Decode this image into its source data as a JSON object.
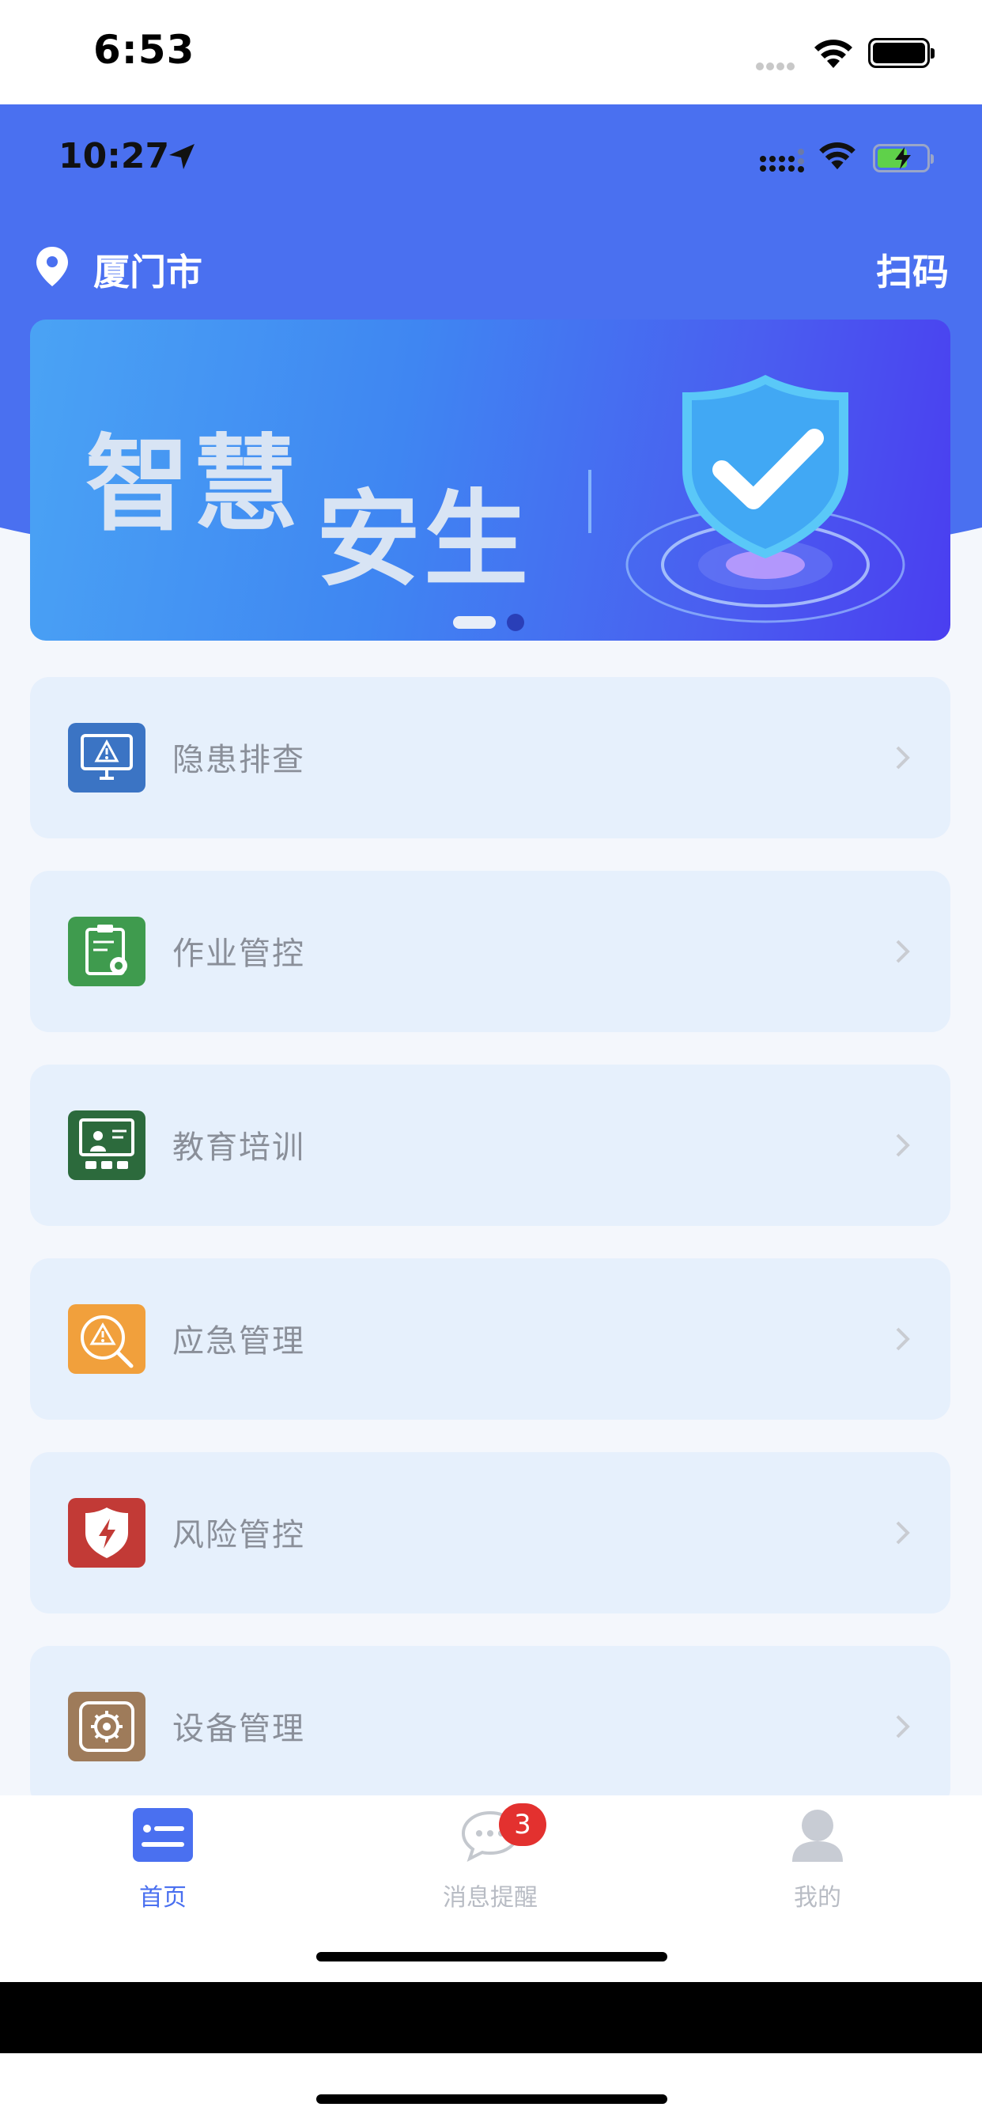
{
  "outer_status": {
    "time": "6:53"
  },
  "inner_status": {
    "time": "10:27"
  },
  "header": {
    "city": "厦门市",
    "scan_label": "扫码"
  },
  "banner": {
    "title_part1": "智慧",
    "title_part2": "安生"
  },
  "menu": [
    {
      "label": "隐患排查",
      "icon": "monitor-warning-icon",
      "color": "#3b74c4"
    },
    {
      "label": "作业管控",
      "icon": "clipboard-gear-icon",
      "color": "#3f9b4e"
    },
    {
      "label": "教育培训",
      "icon": "classroom-icon",
      "color": "#2c6a3c"
    },
    {
      "label": "应急管理",
      "icon": "warning-search-icon",
      "color": "#f1a03c"
    },
    {
      "label": "风险管控",
      "icon": "shield-bolt-icon",
      "color": "#c23a36"
    },
    {
      "label": "设备管理",
      "icon": "device-gear-icon",
      "color": "#9e7b5a"
    }
  ],
  "tabs": {
    "home": "首页",
    "messages": "消息提醒",
    "messages_badge": "3",
    "mine": "我的"
  },
  "colors": {
    "primary": "#4a70f0",
    "badge": "#e3312f"
  }
}
